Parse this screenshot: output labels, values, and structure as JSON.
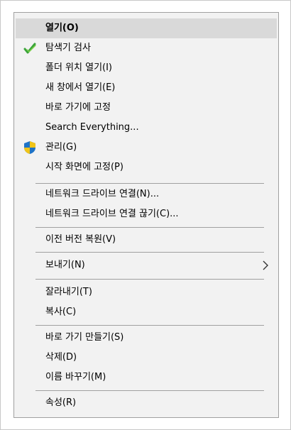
{
  "menu": {
    "items": [
      {
        "label": "열기(O)"
      },
      {
        "label": "탐색기 검사"
      },
      {
        "label": "폴더 위치 열기(I)"
      },
      {
        "label": "새 창에서 열기(E)"
      },
      {
        "label": "바로 가기에 고정"
      },
      {
        "label": "Search Everything..."
      },
      {
        "label": "관리(G)"
      },
      {
        "label": "시작 화면에 고정(P)"
      },
      {
        "label": "네트워크 드라이브 연결(N)..."
      },
      {
        "label": "네트워크 드라이브 연결 끊기(C)..."
      },
      {
        "label": "이전 버전 복원(V)"
      },
      {
        "label": "보내기(N)"
      },
      {
        "label": "잘라내기(T)"
      },
      {
        "label": "복사(C)"
      },
      {
        "label": "바로 가기 만들기(S)"
      },
      {
        "label": "삭제(D)"
      },
      {
        "label": "이름 바꾸기(M)"
      },
      {
        "label": "속성(R)"
      }
    ]
  },
  "icons": {
    "scan_icon": "green-checkmark-scan-icon",
    "manage_icon": "uac-shield-icon",
    "submenu_icon": "chevron-right-icon"
  },
  "colors": {
    "highlight": "#d9d9d9",
    "background": "#f2f2f2",
    "separator": "#a0a0a0"
  }
}
